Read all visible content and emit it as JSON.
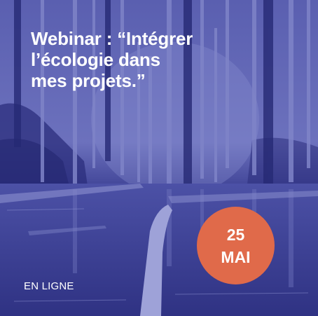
{
  "poster": {
    "title_lines": [
      "Webinar : “Intégrer",
      "l’écologie dans",
      "mes projets.”"
    ],
    "date_day": "25",
    "date_month": "MAI",
    "mode_label": "EN LIGNE"
  },
  "colors": {
    "overlay": "#3d4196",
    "badge": "#e06a4a",
    "text": "#ffffff"
  },
  "background_image": "swamp-forest-photo-duotone"
}
